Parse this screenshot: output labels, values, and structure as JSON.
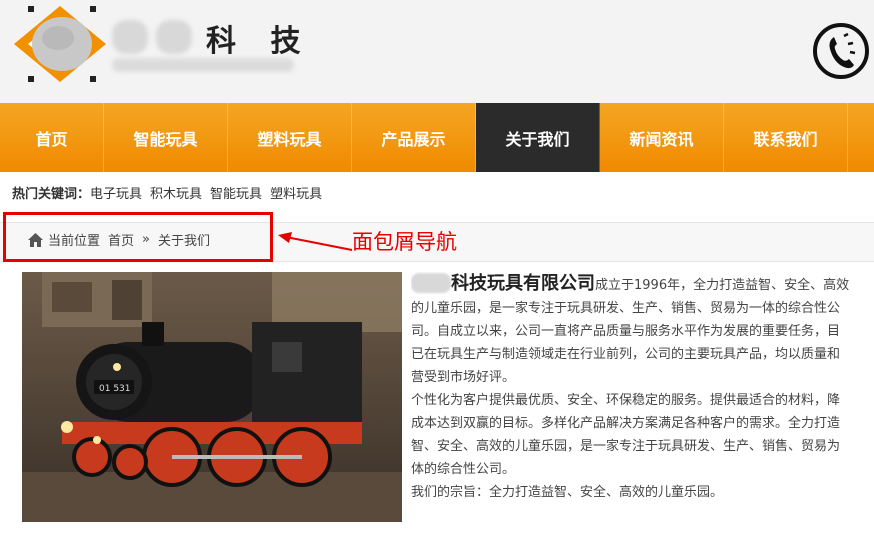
{
  "header": {
    "company_name": "科 技",
    "phone_icon": "phone-icon"
  },
  "nav": {
    "items": [
      {
        "label": "首页"
      },
      {
        "label": "智能玩具"
      },
      {
        "label": "塑料玩具"
      },
      {
        "label": "产品展示"
      },
      {
        "label": "关于我们",
        "active": true
      },
      {
        "label": "新闻资讯"
      },
      {
        "label": "联系我们"
      }
    ],
    "colors": {
      "bar": "#f08a00",
      "active": "#2b2b2b"
    }
  },
  "hotkeys": {
    "label": "热门关键词：",
    "items": [
      "电子玩具",
      "积木玩具",
      "智能玩具",
      "塑料玩具"
    ]
  },
  "breadcrumb": {
    "current_label": "当前位置",
    "home": "首页",
    "separator": "»",
    "page": "关于我们"
  },
  "annotation": {
    "text": "面包屑导航",
    "color": "#e60000"
  },
  "content": {
    "company_title": "科技玩具有限公司",
    "lines": [
      "成立于1996年，全力打造益智、安全、高效",
      "的儿童乐园，是一家专注于玩具研发、生产、销售、贸易为一体的综合性公",
      "司。自成立以来，公司一直将产品质量与服务水平作为发展的重要任务，目",
      "已在玩具生产与制造领域走在行业前列，公司的主要玩具产品，均以质量和",
      "营受到市场好评。",
      "个性化为客户提供最优质、安全、环保稳定的服务。提供最适合的材料，降",
      "成本达到双赢的目标。多样化产品解决方案满足各种客户的需求。全力打造",
      "智、安全、高效的儿童乐园，是一家专注于玩具研发、生产、销售、贸易为",
      "体的综合性公司。",
      "我们的宗旨：全力打造益智、安全、高效的儿童乐园。"
    ],
    "locomotive_number": "01 531"
  }
}
